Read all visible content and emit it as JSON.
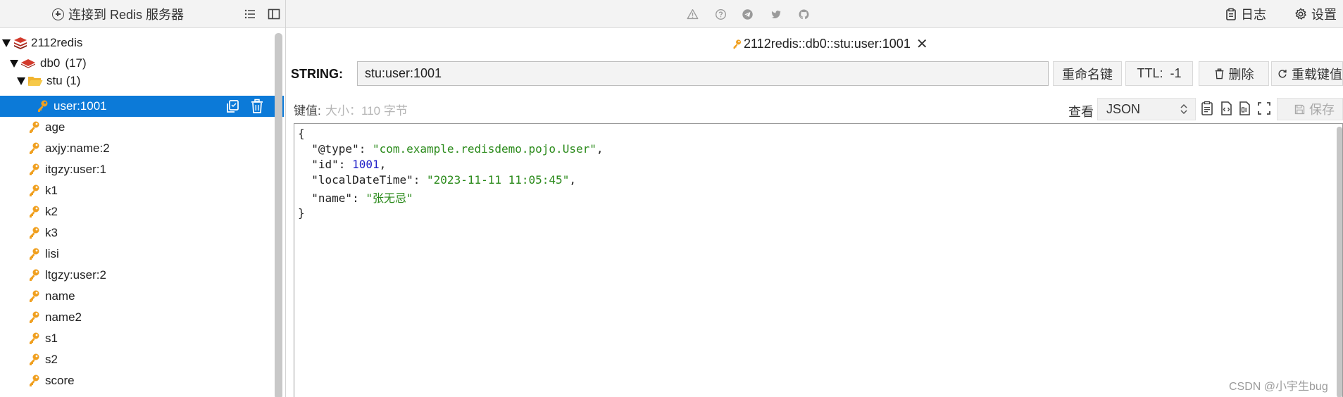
{
  "toolbar": {
    "connect_label": "连接到 Redis 服务器",
    "log_label": "日志",
    "settings_label": "设置"
  },
  "tree": {
    "server": "2112redis",
    "db_label": "db0",
    "db_count": "(17)",
    "folder_label": "stu",
    "folder_count": "(1)",
    "selected_key": "user:1001",
    "keys": [
      "age",
      "axjy:name:2",
      "itgzy:user:1",
      "k1",
      "k2",
      "k3",
      "lisi",
      "ltgzy:user:2",
      "name",
      "name2",
      "s1",
      "s2",
      "score"
    ]
  },
  "tab": {
    "title": "2112redis::db0::stu:user:1001",
    "close_glyph": "✕"
  },
  "key_bar": {
    "type_label": "STRING:",
    "key_name": "stu:user:1001",
    "rename_label": "重命名键",
    "ttl_label": "TTL:  -1",
    "delete_label": "删除",
    "reload_label": "重载键值"
  },
  "value_bar": {
    "value_label": "键值:",
    "size_label": "大小：110 字节",
    "view_label": "查看",
    "view_mode": "JSON",
    "save_label": "保存"
  },
  "editor": {
    "open_brace": "{",
    "close_brace": "}",
    "lines": [
      {
        "key": "\"@type\"",
        "value": "\"com.example.redisdemo.pojo.User\"",
        "kind": "str"
      },
      {
        "key": "\"id\"",
        "value": "1001",
        "kind": "num"
      },
      {
        "key": "\"localDateTime\"",
        "value": "\"2023-11-11 11:05:45\"",
        "kind": "str"
      },
      {
        "key": "\"name\"",
        "value": "\"张无忌\"",
        "kind": "str"
      }
    ]
  },
  "watermark": "CSDN @小宇生bug",
  "colors": {
    "selection": "#0c7ad8",
    "key_icon": "#f0a020",
    "redis_red": "#d33a2c",
    "json_string": "#2a8a1a",
    "json_number": "#2020c8"
  }
}
